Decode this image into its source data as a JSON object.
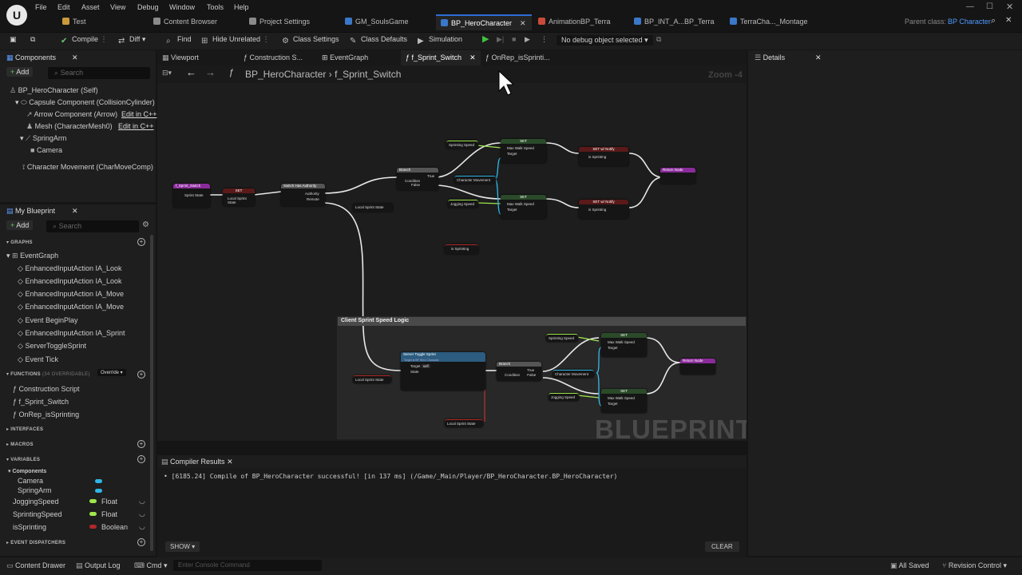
{
  "menu": [
    "File",
    "Edit",
    "Asset",
    "View",
    "Debug",
    "Window",
    "Tools",
    "Help"
  ],
  "doc_tabs": [
    {
      "label": "Test",
      "icon_color": "#c99a3a"
    },
    {
      "label": "Content Browser",
      "icon_color": "#8a8a8a"
    },
    {
      "label": "Project Settings",
      "icon_color": "#8a8a8a"
    },
    {
      "label": "GM_SoulsGame",
      "icon_color": "#3a78c9"
    },
    {
      "label": "BP_HeroCharacter",
      "icon_color": "#3a78c9"
    },
    {
      "label": "AnimationBP_Terra",
      "icon_color": "#c94a3a"
    },
    {
      "label": "BP_INT_A...BP_Terra",
      "icon_color": "#3a78c9"
    },
    {
      "label": "TerraCha..._Montage",
      "icon_color": "#3a78c9"
    }
  ],
  "parent_class": {
    "label": "Parent class:",
    "value": "BP Character"
  },
  "toolbar": {
    "compile": "Compile",
    "diff": "Diff",
    "find": "Find",
    "hide_unrelated": "Hide Unrelated",
    "class_settings": "Class Settings",
    "class_defaults": "Class Defaults",
    "simulation": "Simulation",
    "debug_object": "No debug object selected"
  },
  "components_panel": {
    "title": "Components",
    "add": "Add",
    "search_placeholder": "Search",
    "items": [
      {
        "label": "BP_HeroCharacter (Self)",
        "edit": ""
      },
      {
        "label": "Capsule Component (CollisionCylinder)",
        "edit": ""
      },
      {
        "label": "Arrow Component (Arrow)",
        "edit": "Edit in C++"
      },
      {
        "label": "Mesh (CharacterMesh0)",
        "edit": "Edit in C++"
      },
      {
        "label": "SpringArm",
        "edit": ""
      },
      {
        "label": "Camera",
        "edit": ""
      },
      {
        "label": "Character Movement (CharMoveComp)",
        "edit": ""
      }
    ]
  },
  "my_blueprint": {
    "title": "My Blueprint",
    "add": "Add",
    "search_placeholder": "Search",
    "graphs_header": "GRAPHS",
    "event_graph": "EventGraph",
    "events": [
      "EnhancedInputAction IA_Look",
      "EnhancedInputAction IA_Look",
      "EnhancedInputAction IA_Move",
      "EnhancedInputAction IA_Move",
      "Event BeginPlay",
      "EnhancedInputAction IA_Sprint",
      "ServerToggleSprint",
      "Event Tick"
    ],
    "functions_header": "FUNCTIONS",
    "functions_count": "(34 OVERRIDABLE)",
    "override": "Override",
    "functions": [
      "Construction Script",
      "f_Sprint_Switch",
      "OnRep_isSprinting"
    ],
    "interfaces_header": "INTERFACES",
    "macros_header": "MACROS",
    "variables_header": "VARIABLES",
    "components_group": "Components",
    "component_vars": [
      "Camera",
      "SpringArm"
    ],
    "variables": [
      {
        "name": "JoggingSpeed",
        "type": "Float",
        "color": "#9ee64a"
      },
      {
        "name": "SprintingSpeed",
        "type": "Float",
        "color": "#9ee64a"
      },
      {
        "name": "isSprinting",
        "type": "Boolean",
        "color": "#b02828"
      }
    ],
    "dispatchers_header": "EVENT DISPATCHERS"
  },
  "editor_tabs": [
    "Viewport",
    "Construction S...",
    "EventGraph",
    "f_Sprint_Switch",
    "OnRep_isSprinti..."
  ],
  "breadcrumb": {
    "root": "BP_HeroCharacter",
    "current": "f_Sprint_Switch"
  },
  "zoom": "Zoom -4",
  "comment_title": "Client Sprint Speed Logic",
  "watermark": "BLUEPRINT",
  "details": {
    "title": "Details"
  },
  "compiler": {
    "title": "Compiler Results",
    "message": "[6185.24] Compile of BP_HeroCharacter successful! [in 137 ms] (/Game/_Main/Player/BP_HeroCharacter.BP_HeroCharacter)",
    "show": "SHOW",
    "clear": "CLEAR"
  },
  "status": {
    "content_drawer": "Content Drawer",
    "output_log": "Output Log",
    "cmd": "Cmd",
    "console_placeholder": "Enter Console Command",
    "saved": "All Saved",
    "revision": "Revision Control"
  },
  "nodes": {
    "entry": "f_Sprint_Switch",
    "entry_pin": "Sprint State",
    "set_local": "SET",
    "local_sprint_state": "Local Sprint State",
    "switch_auth": "Switch Has Authority",
    "authority": "Authority",
    "remote": "Remote",
    "branch": "Branch",
    "condition": "Condition",
    "true": "True",
    "false": "False",
    "sprinting_speed": "Sprinting Speed",
    "jogging_speed": "Jogging Speed",
    "char_movement": "Character Movement",
    "set": "SET",
    "max_walk_speed": "Max Walk Speed",
    "target": "Target",
    "set_notify": "SET w/ Notify",
    "is_sprinting": "is Sprinting",
    "return": "Return Node",
    "server_toggle": "Server Toggle Sprint",
    "server_toggle_sub": "Target is BP Hero Character",
    "self": "self",
    "state": "State"
  }
}
